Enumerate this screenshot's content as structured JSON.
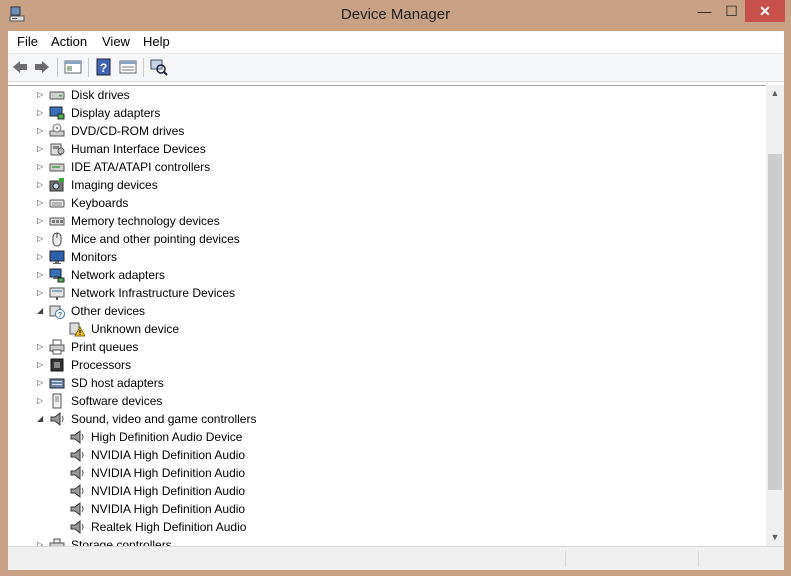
{
  "window": {
    "title": "Device Manager"
  },
  "menu": [
    "File",
    "Action",
    "View",
    "Help"
  ],
  "toolbar": [
    "back-icon",
    "forward-icon",
    "properties-window-icon",
    "help-icon",
    "view-details-icon",
    "scan-hardware-icon"
  ],
  "tree": [
    {
      "label": "Disk drives",
      "level": 0,
      "expanded": false,
      "icon": "disk-drive-icon"
    },
    {
      "label": "Display adapters",
      "level": 0,
      "expanded": false,
      "icon": "display-adapter-icon"
    },
    {
      "label": "DVD/CD-ROM drives",
      "level": 0,
      "expanded": false,
      "icon": "dvd-drive-icon"
    },
    {
      "label": "Human Interface Devices",
      "level": 0,
      "expanded": false,
      "icon": "hid-icon"
    },
    {
      "label": "IDE ATA/ATAPI controllers",
      "level": 0,
      "expanded": false,
      "icon": "ide-controller-icon"
    },
    {
      "label": "Imaging devices",
      "level": 0,
      "expanded": false,
      "icon": "imaging-device-icon"
    },
    {
      "label": "Keyboards",
      "level": 0,
      "expanded": false,
      "icon": "keyboard-icon"
    },
    {
      "label": "Memory technology devices",
      "level": 0,
      "expanded": false,
      "icon": "memory-device-icon"
    },
    {
      "label": "Mice and other pointing devices",
      "level": 0,
      "expanded": false,
      "icon": "mouse-icon"
    },
    {
      "label": "Monitors",
      "level": 0,
      "expanded": false,
      "icon": "monitor-icon"
    },
    {
      "label": "Network adapters",
      "level": 0,
      "expanded": false,
      "icon": "network-adapter-icon"
    },
    {
      "label": "Network Infrastructure Devices",
      "level": 0,
      "expanded": false,
      "icon": "network-infrastructure-icon"
    },
    {
      "label": "Other devices",
      "level": 0,
      "expanded": true,
      "icon": "other-devices-icon"
    },
    {
      "label": "Unknown device",
      "level": 1,
      "icon": "unknown-device-warning-icon"
    },
    {
      "label": "Print queues",
      "level": 0,
      "expanded": false,
      "icon": "printer-icon"
    },
    {
      "label": "Processors",
      "level": 0,
      "expanded": false,
      "icon": "processor-icon"
    },
    {
      "label": "SD host adapters",
      "level": 0,
      "expanded": false,
      "icon": "sd-host-icon"
    },
    {
      "label": "Software devices",
      "level": 0,
      "expanded": false,
      "icon": "software-device-icon"
    },
    {
      "label": "Sound, video and game controllers",
      "level": 0,
      "expanded": true,
      "icon": "speaker-icon"
    },
    {
      "label": "High Definition Audio Device",
      "level": 1,
      "icon": "speaker-icon"
    },
    {
      "label": "NVIDIA High Definition Audio",
      "level": 1,
      "icon": "speaker-icon"
    },
    {
      "label": "NVIDIA High Definition Audio",
      "level": 1,
      "icon": "speaker-icon"
    },
    {
      "label": "NVIDIA High Definition Audio",
      "level": 1,
      "icon": "speaker-icon"
    },
    {
      "label": "NVIDIA High Definition Audio",
      "level": 1,
      "icon": "speaker-icon"
    },
    {
      "label": "Realtek High Definition Audio",
      "level": 1,
      "icon": "speaker-icon"
    },
    {
      "label": "Storage controllers",
      "level": 0,
      "expanded": false,
      "icon": "storage-controller-icon"
    }
  ],
  "colors": {
    "window_frame": "#c9a184",
    "close_button": "#c7504a"
  }
}
